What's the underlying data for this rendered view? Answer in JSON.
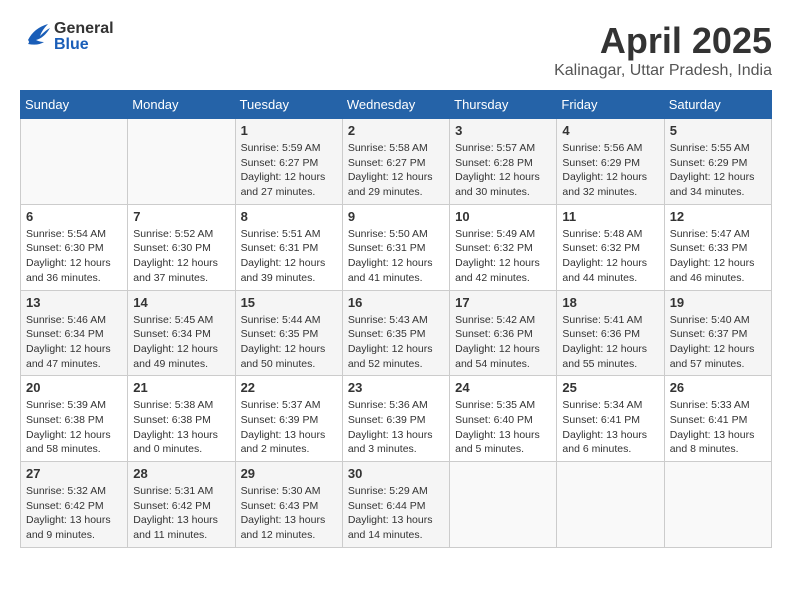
{
  "header": {
    "logo_general": "General",
    "logo_blue": "Blue",
    "month_title": "April 2025",
    "location": "Kalinagar, Uttar Pradesh, India"
  },
  "weekdays": [
    "Sunday",
    "Monday",
    "Tuesday",
    "Wednesday",
    "Thursday",
    "Friday",
    "Saturday"
  ],
  "weeks": [
    [
      {
        "day": "",
        "info": ""
      },
      {
        "day": "",
        "info": ""
      },
      {
        "day": "1",
        "info": "Sunrise: 5:59 AM\nSunset: 6:27 PM\nDaylight: 12 hours and 27 minutes."
      },
      {
        "day": "2",
        "info": "Sunrise: 5:58 AM\nSunset: 6:27 PM\nDaylight: 12 hours and 29 minutes."
      },
      {
        "day": "3",
        "info": "Sunrise: 5:57 AM\nSunset: 6:28 PM\nDaylight: 12 hours and 30 minutes."
      },
      {
        "day": "4",
        "info": "Sunrise: 5:56 AM\nSunset: 6:29 PM\nDaylight: 12 hours and 32 minutes."
      },
      {
        "day": "5",
        "info": "Sunrise: 5:55 AM\nSunset: 6:29 PM\nDaylight: 12 hours and 34 minutes."
      }
    ],
    [
      {
        "day": "6",
        "info": "Sunrise: 5:54 AM\nSunset: 6:30 PM\nDaylight: 12 hours and 36 minutes."
      },
      {
        "day": "7",
        "info": "Sunrise: 5:52 AM\nSunset: 6:30 PM\nDaylight: 12 hours and 37 minutes."
      },
      {
        "day": "8",
        "info": "Sunrise: 5:51 AM\nSunset: 6:31 PM\nDaylight: 12 hours and 39 minutes."
      },
      {
        "day": "9",
        "info": "Sunrise: 5:50 AM\nSunset: 6:31 PM\nDaylight: 12 hours and 41 minutes."
      },
      {
        "day": "10",
        "info": "Sunrise: 5:49 AM\nSunset: 6:32 PM\nDaylight: 12 hours and 42 minutes."
      },
      {
        "day": "11",
        "info": "Sunrise: 5:48 AM\nSunset: 6:32 PM\nDaylight: 12 hours and 44 minutes."
      },
      {
        "day": "12",
        "info": "Sunrise: 5:47 AM\nSunset: 6:33 PM\nDaylight: 12 hours and 46 minutes."
      }
    ],
    [
      {
        "day": "13",
        "info": "Sunrise: 5:46 AM\nSunset: 6:34 PM\nDaylight: 12 hours and 47 minutes."
      },
      {
        "day": "14",
        "info": "Sunrise: 5:45 AM\nSunset: 6:34 PM\nDaylight: 12 hours and 49 minutes."
      },
      {
        "day": "15",
        "info": "Sunrise: 5:44 AM\nSunset: 6:35 PM\nDaylight: 12 hours and 50 minutes."
      },
      {
        "day": "16",
        "info": "Sunrise: 5:43 AM\nSunset: 6:35 PM\nDaylight: 12 hours and 52 minutes."
      },
      {
        "day": "17",
        "info": "Sunrise: 5:42 AM\nSunset: 6:36 PM\nDaylight: 12 hours and 54 minutes."
      },
      {
        "day": "18",
        "info": "Sunrise: 5:41 AM\nSunset: 6:36 PM\nDaylight: 12 hours and 55 minutes."
      },
      {
        "day": "19",
        "info": "Sunrise: 5:40 AM\nSunset: 6:37 PM\nDaylight: 12 hours and 57 minutes."
      }
    ],
    [
      {
        "day": "20",
        "info": "Sunrise: 5:39 AM\nSunset: 6:38 PM\nDaylight: 12 hours and 58 minutes."
      },
      {
        "day": "21",
        "info": "Sunrise: 5:38 AM\nSunset: 6:38 PM\nDaylight: 13 hours and 0 minutes."
      },
      {
        "day": "22",
        "info": "Sunrise: 5:37 AM\nSunset: 6:39 PM\nDaylight: 13 hours and 2 minutes."
      },
      {
        "day": "23",
        "info": "Sunrise: 5:36 AM\nSunset: 6:39 PM\nDaylight: 13 hours and 3 minutes."
      },
      {
        "day": "24",
        "info": "Sunrise: 5:35 AM\nSunset: 6:40 PM\nDaylight: 13 hours and 5 minutes."
      },
      {
        "day": "25",
        "info": "Sunrise: 5:34 AM\nSunset: 6:41 PM\nDaylight: 13 hours and 6 minutes."
      },
      {
        "day": "26",
        "info": "Sunrise: 5:33 AM\nSunset: 6:41 PM\nDaylight: 13 hours and 8 minutes."
      }
    ],
    [
      {
        "day": "27",
        "info": "Sunrise: 5:32 AM\nSunset: 6:42 PM\nDaylight: 13 hours and 9 minutes."
      },
      {
        "day": "28",
        "info": "Sunrise: 5:31 AM\nSunset: 6:42 PM\nDaylight: 13 hours and 11 minutes."
      },
      {
        "day": "29",
        "info": "Sunrise: 5:30 AM\nSunset: 6:43 PM\nDaylight: 13 hours and 12 minutes."
      },
      {
        "day": "30",
        "info": "Sunrise: 5:29 AM\nSunset: 6:44 PM\nDaylight: 13 hours and 14 minutes."
      },
      {
        "day": "",
        "info": ""
      },
      {
        "day": "",
        "info": ""
      },
      {
        "day": "",
        "info": ""
      }
    ]
  ]
}
